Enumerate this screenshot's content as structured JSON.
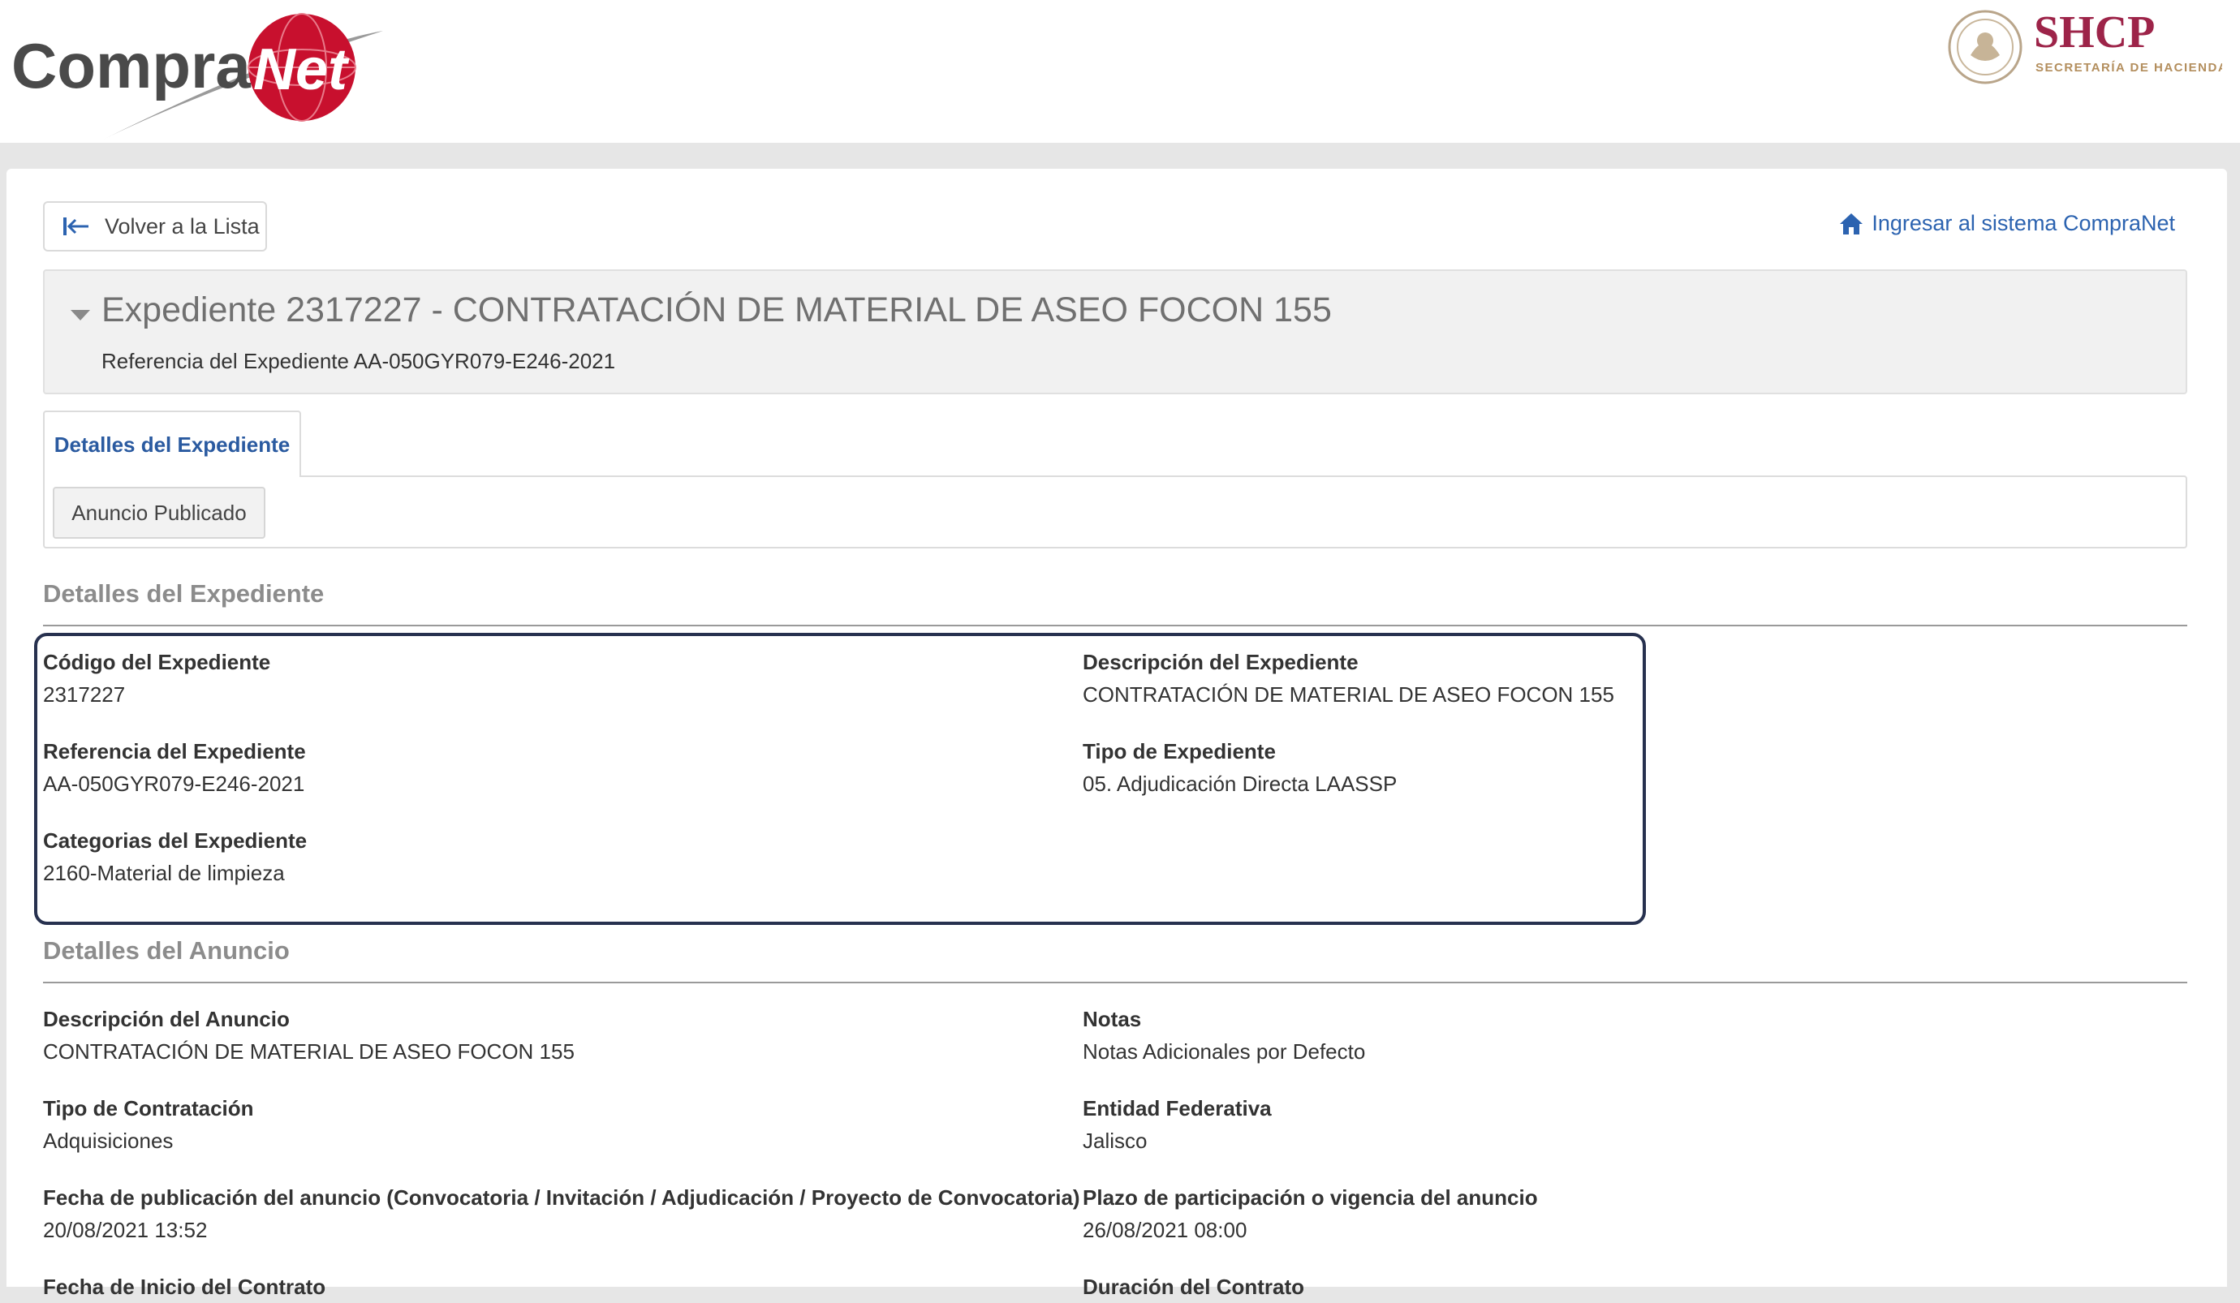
{
  "header": {
    "logo_text": "CompraNet",
    "logo_part1": "Compra",
    "logo_part2": "Net",
    "agency_logo": "SHCP",
    "agency_name": "SECRETARÍA DE HACIENDA"
  },
  "nav": {
    "back_label": "Volver a la Lista",
    "back_icon": "arrow-to-start-icon",
    "login_label": "Ingresar al sistema CompraNet",
    "login_icon": "home-icon"
  },
  "expediente": {
    "title": "Expediente 2317227 - CONTRATACIÓN DE MATERIAL DE ASEO FOCON 155",
    "reference": "Referencia del Expediente AA-050GYR079-E246-2021"
  },
  "tabs": [
    {
      "label": "Detalles del Expediente",
      "active": true
    }
  ],
  "subtabs": [
    {
      "label": "Anuncio Publicado"
    }
  ],
  "detalles_expediente": {
    "title": "Detalles del Expediente",
    "fields": [
      {
        "label": "Código del Expediente",
        "value": "2317227"
      },
      {
        "label": "Descripción del Expediente",
        "value": "CONTRATACIÓN DE MATERIAL DE ASEO FOCON 155"
      },
      {
        "label": "Referencia del Expediente",
        "value": "AA-050GYR079-E246-2021"
      },
      {
        "label": "Tipo de Expediente",
        "value": "05. Adjudicación Directa LAASSP"
      },
      {
        "label": "Categorias del Expediente",
        "value": "2160-Material de limpieza"
      }
    ]
  },
  "detalles_anuncio": {
    "title": "Detalles del Anuncio",
    "fields": [
      {
        "label": "Descripción del Anuncio",
        "value": "CONTRATACIÓN DE MATERIAL DE ASEO FOCON 155"
      },
      {
        "label": "Notas",
        "value": "Notas Adicionales por Defecto"
      },
      {
        "label": "Tipo de Contratación",
        "value": "Adquisiciones"
      },
      {
        "label": "Entidad Federativa",
        "value": "Jalisco"
      },
      {
        "label": "Fecha de publicación del anuncio (Convocatoria / Invitación / Adjudicación / Proyecto de Convocatoria)",
        "value": "20/08/2021 13:52"
      },
      {
        "label": "Plazo de participación o vigencia del anuncio",
        "value": "26/08/2021 08:00"
      },
      {
        "label": "Fecha de Inicio del Contrato",
        "value": ""
      },
      {
        "label": "Duración del Contrato",
        "value": ""
      }
    ]
  },
  "colors": {
    "link": "#2c63b0",
    "tab_active": "#2a5aa0",
    "brand_red": "#c8102e",
    "shcp_maroon": "#9d2449",
    "highlight_border": "#27314f"
  }
}
